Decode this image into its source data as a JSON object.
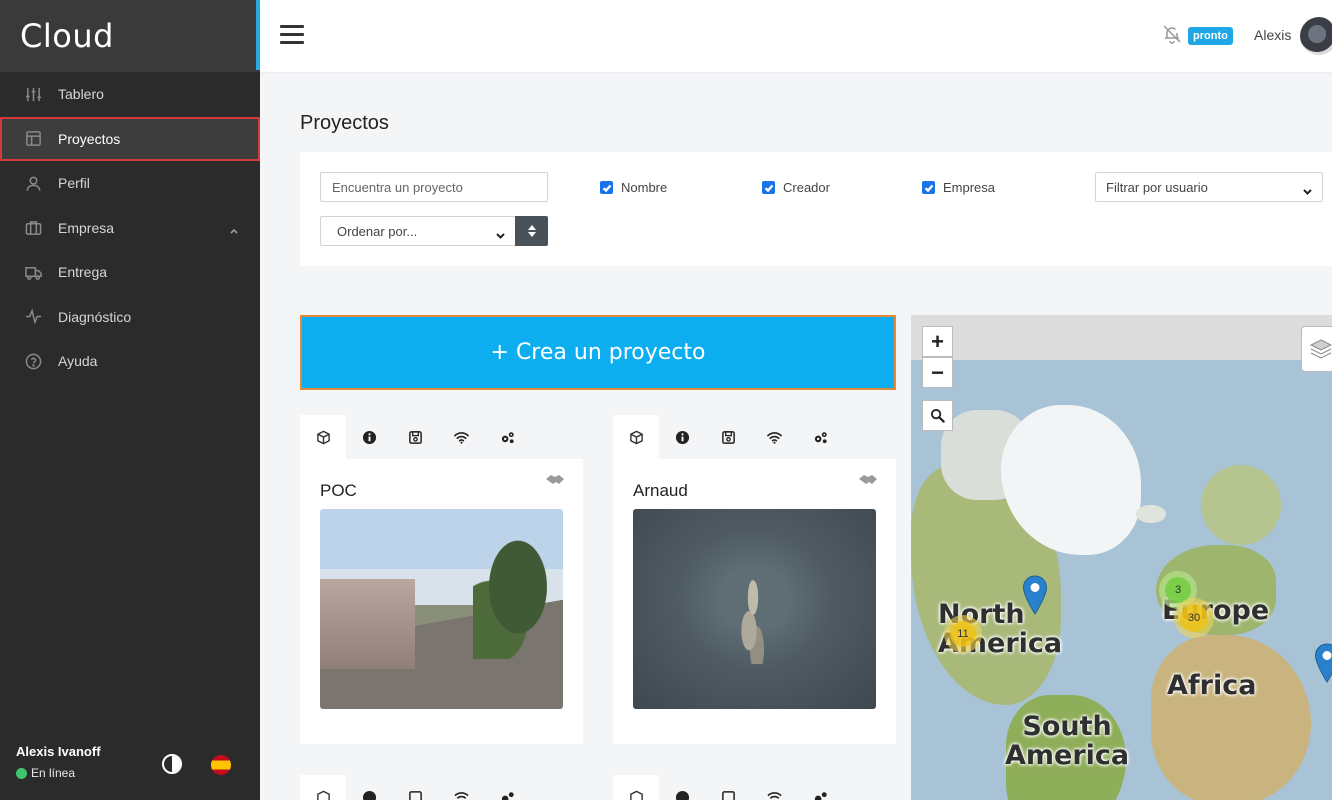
{
  "app": {
    "brand": "Cloud"
  },
  "sidebar": {
    "items": [
      {
        "label": "Tablero",
        "icon": "sliders-icon"
      },
      {
        "label": "Proyectos",
        "icon": "layout-icon"
      },
      {
        "label": "Perfil",
        "icon": "user-icon"
      },
      {
        "label": "Empresa",
        "icon": "briefcase-icon"
      },
      {
        "label": "Entrega",
        "icon": "truck-icon"
      },
      {
        "label": "Diagnóstico",
        "icon": "activity-icon"
      },
      {
        "label": "Ayuda",
        "icon": "help-icon"
      }
    ],
    "active_index": 1,
    "footer": {
      "user_name": "Alexis Ivanoff",
      "status": "En línea",
      "status_color": "#3ec56e"
    }
  },
  "topbar": {
    "badge": "pronto",
    "user": "Alexis"
  },
  "page": {
    "title": "Proyectos",
    "filters": {
      "search_placeholder": "Encuentra un proyecto",
      "checkboxes": [
        {
          "label": "Nombre",
          "checked": true
        },
        {
          "label": "Creador",
          "checked": true
        },
        {
          "label": "Empresa",
          "checked": true
        }
      ],
      "user_filter": "Filtrar por usuario",
      "sort": "Ordenar por..."
    },
    "create_button": "+ Crea un proyecto",
    "projects": [
      {
        "title": "POC"
      },
      {
        "title": "Arnaud"
      }
    ]
  },
  "map": {
    "zoom_in": "+",
    "zoom_out": "−",
    "labels": [
      {
        "text": "North\nAmerica"
      },
      {
        "text": "Europe"
      },
      {
        "text": "Africa"
      },
      {
        "text": "South\nAmerica"
      }
    ],
    "clusters": [
      {
        "count": "11",
        "color": "yellow"
      },
      {
        "count": "3",
        "color": "green"
      },
      {
        "count": "30",
        "color": "yellow"
      }
    ]
  },
  "colors": {
    "accent": "#0daeef",
    "sidebar_bg": "#2b2b2b",
    "active_outline": "#d43a3a",
    "badge": "#1ea7e4"
  }
}
